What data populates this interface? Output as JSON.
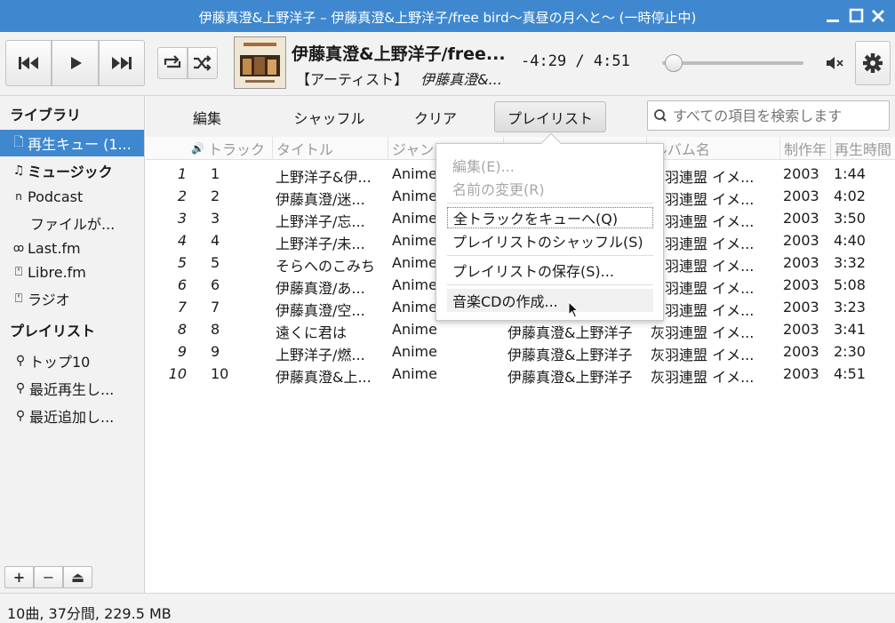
{
  "window": {
    "title": "伊藤真澄&上野洋子 – 伊藤真澄&上野洋子/free bird～真昼の月へと～ (一時停止中)"
  },
  "now_playing": {
    "title": "伊藤真澄&上野洋子/free...",
    "artist_label": "【アーティスト】",
    "artist": "伊藤真澄&...",
    "time": "-4:29 / 4:51",
    "progress": 0.08
  },
  "sidebar": {
    "library_heading": "ライブラリ",
    "library_items": [
      {
        "label": "再生キュー (1...",
        "icon": "document-icon"
      },
      {
        "label": "ミュージック",
        "icon": "music-note-icon"
      },
      {
        "label": "Podcast",
        "icon": "rss-icon"
      },
      {
        "label": "ファイルが...",
        "icon": ""
      },
      {
        "label": "Last.fm",
        "icon": "lastfm-icon"
      },
      {
        "label": "Libre.fm",
        "icon": "radio-device-icon"
      },
      {
        "label": "ラジオ",
        "icon": "radio-device-icon"
      }
    ],
    "playlist_heading": "プレイリスト",
    "playlist_items": [
      {
        "label": "トップ10",
        "icon": "search-icon"
      },
      {
        "label": "最近再生し...",
        "icon": "search-icon"
      },
      {
        "label": "最近追加し...",
        "icon": "search-icon"
      }
    ],
    "buttons": {
      "add": "+",
      "remove": "−",
      "eject": "⏏"
    }
  },
  "main_toolbar": {
    "edit": "編集",
    "shuffle": "シャッフル",
    "clear": "クリア",
    "playlist": "プレイリスト"
  },
  "search": {
    "placeholder": "すべての項目を検索します"
  },
  "columns": {
    "track": "トラック",
    "title": "タイトル",
    "genre": "ジャン",
    "album": "アルバム名",
    "year": "制作年",
    "time": "再生時間"
  },
  "tracks": [
    {
      "n": "1",
      "track": "1",
      "title": "上野洋子&伊...",
      "genre": "Anime",
      "artist": "",
      "album": "灰羽連盟 イメ...",
      "year": "2003",
      "time": "1:44"
    },
    {
      "n": "2",
      "track": "2",
      "title": "伊藤真澄/迷...",
      "genre": "Anime",
      "artist": "",
      "album": "灰羽連盟 イメ...",
      "year": "2003",
      "time": "4:02"
    },
    {
      "n": "3",
      "track": "3",
      "title": "上野洋子/忘...",
      "genre": "Anime",
      "artist": "",
      "album": "灰羽連盟 イメ...",
      "year": "2003",
      "time": "3:50"
    },
    {
      "n": "4",
      "track": "4",
      "title": "上野洋子/未...",
      "genre": "Anime",
      "artist": "",
      "album": "灰羽連盟 イメ...",
      "year": "2003",
      "time": "4:40"
    },
    {
      "n": "5",
      "track": "5",
      "title": "そらへのこみち",
      "genre": "Anime",
      "artist": "",
      "album": "灰羽連盟 イメ...",
      "year": "2003",
      "time": "3:32"
    },
    {
      "n": "6",
      "track": "6",
      "title": "伊藤真澄/あ...",
      "genre": "Anime",
      "artist": "",
      "album": "灰羽連盟 イメ...",
      "year": "2003",
      "time": "5:08"
    },
    {
      "n": "7",
      "track": "7",
      "title": "伊藤真澄/空...",
      "genre": "Anime",
      "artist": "",
      "album": "灰羽連盟 イメ...",
      "year": "2003",
      "time": "3:23"
    },
    {
      "n": "8",
      "track": "8",
      "title": "遠くに君は",
      "genre": "Anime",
      "artist": "伊藤真澄&上野洋子",
      "album": "灰羽連盟 イメ...",
      "year": "2003",
      "time": "3:41"
    },
    {
      "n": "9",
      "track": "9",
      "title": "上野洋子/燃...",
      "genre": "Anime",
      "artist": "伊藤真澄&上野洋子",
      "album": "灰羽連盟 イメ...",
      "year": "2003",
      "time": "2:30"
    },
    {
      "n": "10",
      "track": "10",
      "title": "伊藤真澄&上...",
      "genre": "Anime",
      "artist": "伊藤真澄&上野洋子",
      "album": "灰羽連盟 イメ...",
      "year": "2003",
      "time": "4:51"
    }
  ],
  "popup_menu": {
    "edit": "編集(E)...",
    "rename": "名前の変更(R)",
    "queue_all": "全トラックをキューへ(Q)",
    "shuffle": "プレイリストのシャッフル(S)",
    "save": "プレイリストの保存(S)...",
    "burn_cd": "音楽CDの作成..."
  },
  "status": "10曲, 37分間, 229.5 MB",
  "colors": {
    "accent": "#3f88cf",
    "titlebar": "#3f88cf"
  }
}
